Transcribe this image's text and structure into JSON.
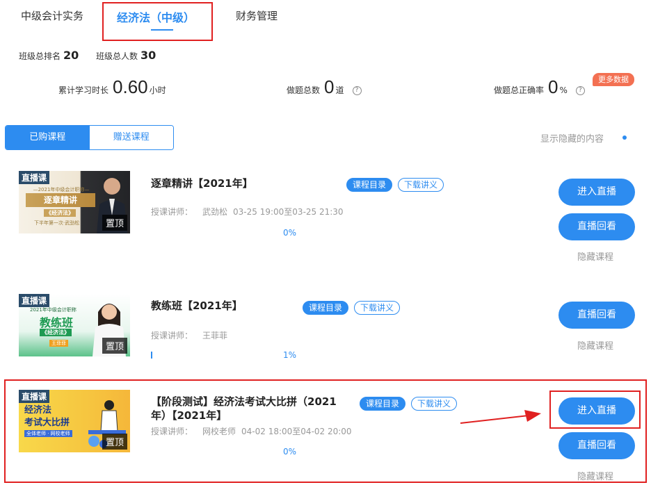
{
  "tabs": [
    {
      "label": "中级会计实务"
    },
    {
      "label": "经济法（中级）"
    },
    {
      "label": "财务管理"
    }
  ],
  "rank": {
    "class_rank_label": "班级总排名",
    "class_rank_value": "20",
    "class_total_label": "班级总人数",
    "class_total_value": "30"
  },
  "stats": {
    "study_time_label": "累计学习时长",
    "study_time_value": "0.60",
    "study_time_unit": "小时",
    "questions_label": "做题总数",
    "questions_value": "0",
    "questions_unit": "道",
    "accuracy_label": "做题总正确率",
    "accuracy_value": "0",
    "accuracy_unit": "%",
    "help_glyph": "?",
    "more_data": "更多数据"
  },
  "segment": {
    "purchased": "已购课程",
    "gifted": "赠送课程"
  },
  "show_hidden": "显示隐藏的内容",
  "courses": [
    {
      "thumb": {
        "live": "直播课",
        "pin": "置顶",
        "line1": "—2021年中级会计职称—",
        "line2": "逐章精讲",
        "line3": "《经济法》",
        "line4": "下半年第一次·武劲松"
      },
      "title": "逐章精讲【2021年】",
      "catalog": "课程目录",
      "download": "下载讲义",
      "teacher_label": "授课讲师：",
      "teacher": "武劲松",
      "time": "03-25 19:00至03-25 21:30",
      "progress": "0%",
      "enter_live": "进入直播",
      "replay": "直播回看",
      "hide": "隐藏课程"
    },
    {
      "thumb": {
        "live": "直播课",
        "pin": "置顶",
        "line1": "2021年中级会计职称",
        "line2": "教练班",
        "line3": "《经济法》",
        "line4": "王菲菲"
      },
      "title": "教练班【2021年】",
      "catalog": "课程目录",
      "download": "下载讲义",
      "teacher_label": "授课讲师：",
      "teacher": "王菲菲",
      "progress": "1%",
      "replay": "直播回看",
      "hide": "隐藏课程"
    },
    {
      "thumb": {
        "live": "直播课",
        "pin": "置顶",
        "line1": "经济法",
        "line2": "考试大比拼",
        "line3": "全体老师 · 网校老师"
      },
      "title_line1": "【阶段测试】经济法考试大比拼（2021",
      "title_line2": "年）【2021年】",
      "catalog": "课程目录",
      "download": "下载讲义",
      "teacher_label": "授课讲师：",
      "teacher": "网校老师",
      "time": "04-02 18:00至04-02 20:00",
      "progress": "0%",
      "enter_live": "进入直播",
      "replay": "直播回看",
      "hide": "隐藏课程"
    }
  ],
  "colors": {
    "accent": "#2d8cf0",
    "highlight_box": "#e02020",
    "badge": "#f37052"
  }
}
